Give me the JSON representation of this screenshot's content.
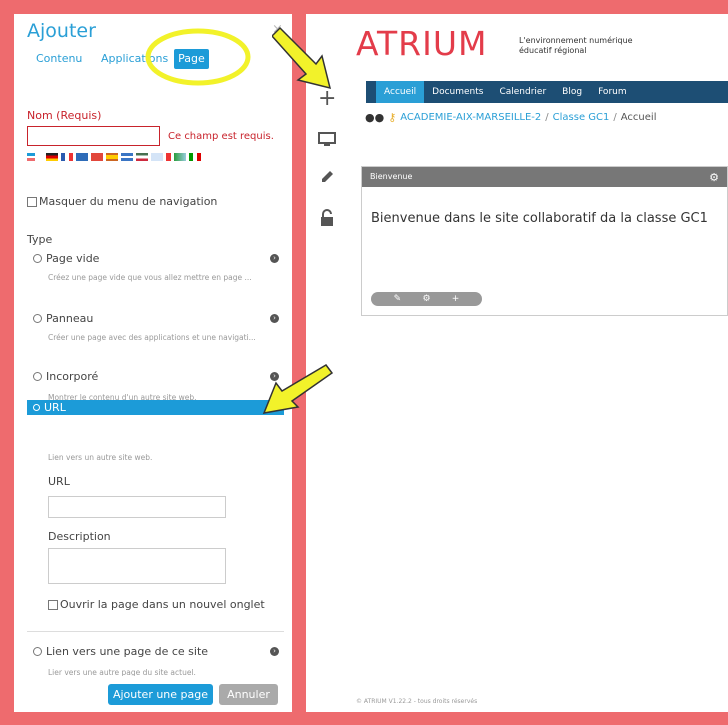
{
  "panel": {
    "title": "Ajouter",
    "close": "×",
    "tabs": [
      "Contenu",
      "Applications",
      "Page"
    ],
    "name_label": "Nom (Requis)",
    "name_value": "",
    "name_error": "Ce champ est requis.",
    "hide_nav": "Masquer du menu de navigation",
    "type_label": "Type",
    "options": [
      {
        "label": "Page vide",
        "desc": "Créez une page vide que vous allez mettre en page ..."
      },
      {
        "label": "Panneau",
        "desc": "Créer une page avec des applications et une navigati..."
      },
      {
        "label": "Incorporé",
        "desc": "Montrer le contenu d'un autre site web."
      },
      {
        "label": "URL",
        "desc": "Lien vers un autre site web."
      },
      {
        "label": "Lien vers une page de ce site",
        "desc": "Lier vers une autre page du site actuel."
      }
    ],
    "url_label": "URL",
    "description_label": "Description",
    "new_tab": "Ouvrir la page dans un nouvel onglet",
    "add_button": "Ajouter une page",
    "cancel_button": "Annuler"
  },
  "site": {
    "logo": "ATRIUM",
    "tagline_1": "L'environnement numérique",
    "tagline_2": "éducatif régional",
    "nav": [
      "Accueil",
      "Documents",
      "Calendrier",
      "Blog",
      "Forum"
    ],
    "breadcrumb": [
      "ACADEMIE-AIX-MARSEILLE-2",
      "Classe GC1",
      "Accueil"
    ],
    "widget_title": "Bienvenue",
    "widget_text": "Bienvenue dans le site collaboratif da la classe GC1",
    "footer": "© ATRIUM V1.22.2 - tous droits réservés"
  },
  "colors": {
    "background": "#ee6b6e",
    "accent": "#1c9bd8",
    "navbar": "#1d4e74",
    "error": "#c8232c",
    "logo": "#e33c4a",
    "highlight": "#f2f22a"
  }
}
